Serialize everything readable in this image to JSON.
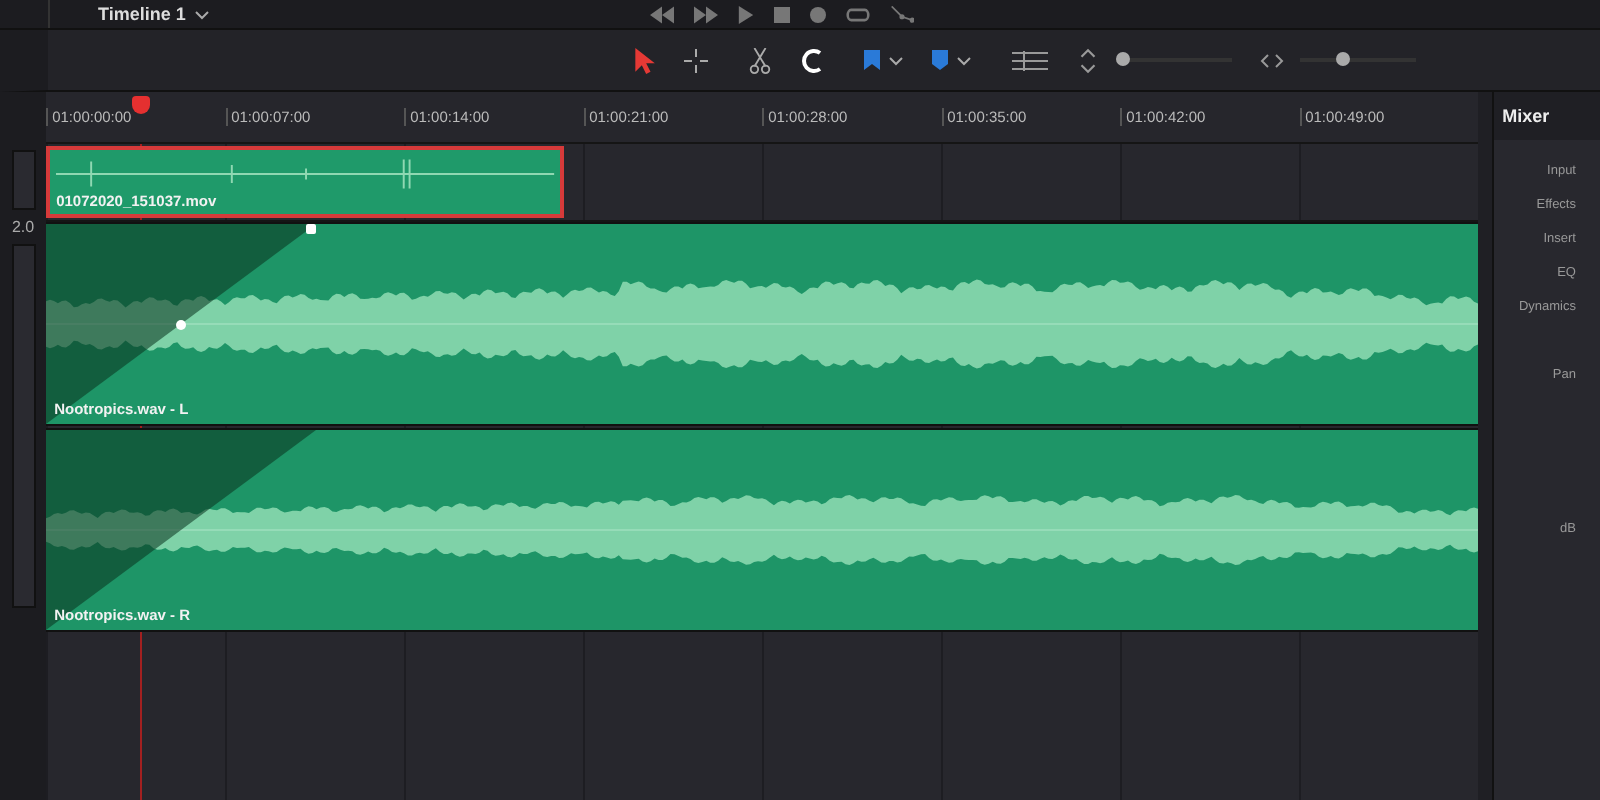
{
  "timeline": {
    "title": "Timeline 1"
  },
  "transport": [
    {
      "kind": "rewind"
    },
    {
      "kind": "forward"
    },
    {
      "kind": "play"
    },
    {
      "kind": "stop"
    },
    {
      "kind": "record"
    },
    {
      "kind": "loop"
    },
    {
      "kind": "nodes"
    }
  ],
  "tools": [
    {
      "kind": "pointer",
      "selected": true
    },
    {
      "kind": "trim",
      "selected": false
    },
    {
      "kind": "blade",
      "selected": false
    },
    {
      "kind": "snap",
      "selected": true
    },
    {
      "kind": "flag",
      "selected": false
    },
    {
      "kind": "marker",
      "selected": false
    },
    {
      "kind": "tracks",
      "selected": false
    }
  ],
  "zoom_sliders": [
    {
      "kind": "vertical",
      "level": 0.0
    },
    {
      "kind": "horizontal",
      "level": 0.35
    }
  ],
  "ruler": [
    "01:00:00:00",
    "01:00:07:00",
    "01:00:14:00",
    "01:00:21:00",
    "01:00:28:00",
    "01:00:35:00",
    "01:00:42:00",
    "01:00:49:00"
  ],
  "video_clip": {
    "name": "01072020_151037.mov",
    "selected": true
  },
  "audio_level_label": "2.0",
  "audio_clips": [
    {
      "name": "Nootropics.wav - L"
    },
    {
      "name": "Nootropics.wav - R"
    }
  ],
  "mixer": {
    "title": "Mixer",
    "rows": [
      "Input",
      "Effects",
      "Insert",
      "EQ",
      "Dynamics",
      "Pan",
      "dB"
    ]
  }
}
